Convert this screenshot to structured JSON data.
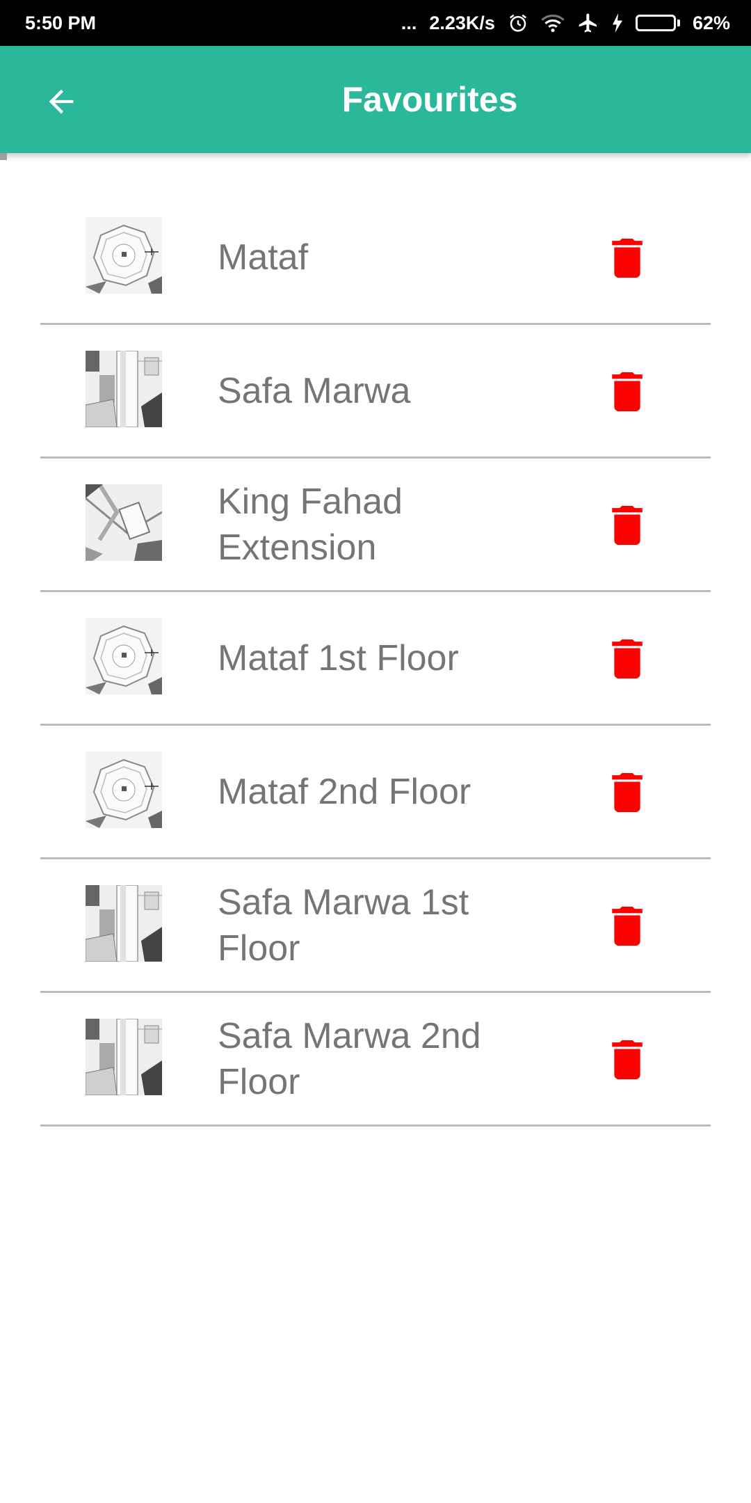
{
  "status_bar": {
    "time": "5:50 PM",
    "dots": "...",
    "network_speed": "2.23K/s",
    "battery_percent": "62%",
    "battery_level": 0.62,
    "icons": [
      "alarm-icon",
      "wifi-icon",
      "airplane-icon",
      "charging-icon",
      "battery-icon"
    ]
  },
  "app_bar": {
    "title": "Favourites",
    "color": "#2bb89a",
    "back_icon": "arrow-left-icon"
  },
  "favourites": [
    {
      "name": "Mataf",
      "thumb": "map-thumb-mataf"
    },
    {
      "name": "Safa Marwa",
      "thumb": "map-thumb-safa-marwa"
    },
    {
      "name": "King Fahad Extension",
      "thumb": "map-thumb-king-fahad"
    },
    {
      "name": "Mataf 1st Floor",
      "thumb": "map-thumb-mataf"
    },
    {
      "name": "Mataf 2nd Floor",
      "thumb": "map-thumb-mataf"
    },
    {
      "name": "Safa Marwa 1st Floor",
      "thumb": "map-thumb-safa-marwa"
    },
    {
      "name": "Safa Marwa 2nd Floor",
      "thumb": "map-thumb-safa-marwa"
    }
  ],
  "colors": {
    "delete": "#ff0000",
    "label": "#757575",
    "divider": "#bdbdbd"
  }
}
